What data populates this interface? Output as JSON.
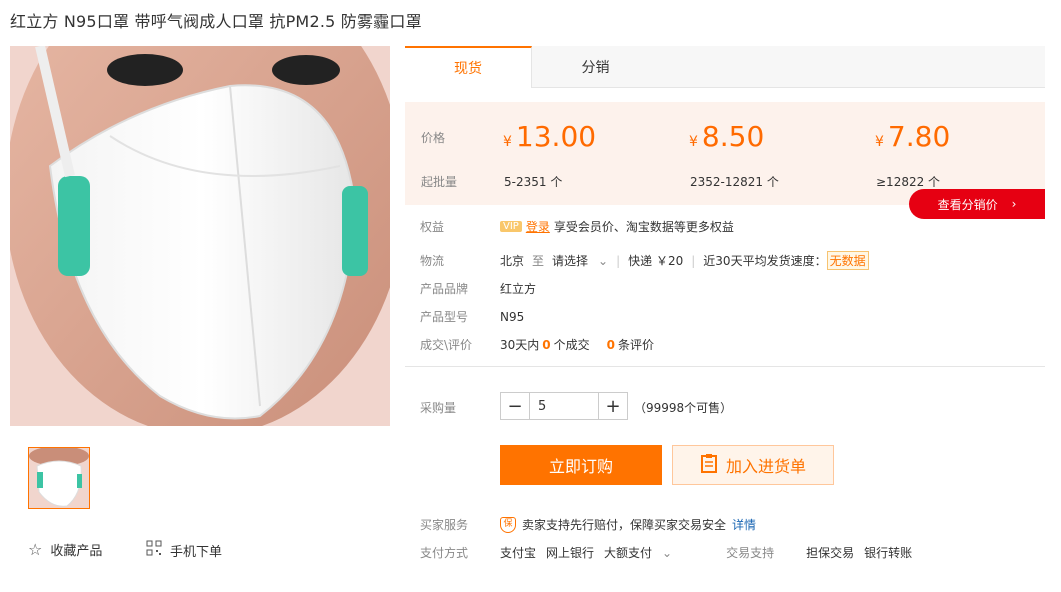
{
  "product": {
    "title": "红立方 N95口罩 带呼气阀成人口罩 抗PM2.5 防雾霾口罩"
  },
  "gallery": {
    "favorite_label": "收藏产品",
    "mobile_order_label": "手机下单"
  },
  "tabs": [
    {
      "label": "现货"
    },
    {
      "label": "分销"
    }
  ],
  "price_box": {
    "price_label": "价格",
    "moq_label": "起批量",
    "currency": "¥",
    "tiers": [
      {
        "price": "13.00",
        "qty": "5-2351 个"
      },
      {
        "price": "8.50",
        "qty": "2352-12821 个"
      },
      {
        "price": "7.80",
        "qty": "≥12822 个"
      }
    ],
    "dist_button": "查看分销价",
    "accent": "#ff6a00"
  },
  "details": {
    "benefits_label": "权益",
    "vip_badge": "VIP",
    "login_link": "登录",
    "benefits_text": "享受会员价、淘宝数据等更多权益",
    "logistics_label": "物流",
    "from": "北京",
    "to_word": "至",
    "select_text": "请选择",
    "express": "快递 ￥20",
    "speed_text": "近30天平均发货速度：",
    "no_data": "无数据",
    "brand_label": "产品品牌",
    "brand_value": "红立方",
    "model_label": "产品型号",
    "model_value": "N95",
    "deals_label": "成交\\评价",
    "deals_prefix": "30天内",
    "deals_count": "0",
    "deals_suffix": "个成交",
    "review_count": "0",
    "review_suffix": "条评价"
  },
  "purchase": {
    "qty_label": "采购量",
    "quantity": "5",
    "stock_text": "（99998个可售）",
    "buy_now": "立即订购",
    "add_cart": "加入进货单"
  },
  "service": {
    "buyer_service_label": "买家服务",
    "shield_text": "保",
    "buyer_service_text": "卖家支持先行赔付，保障买家交易安全",
    "details_link": "详情",
    "payment_label": "支付方式",
    "payments": [
      "支付宝",
      "网上银行",
      "大额支付"
    ],
    "trade_label": "交易支持",
    "trades": [
      "担保交易",
      "银行转账"
    ]
  }
}
